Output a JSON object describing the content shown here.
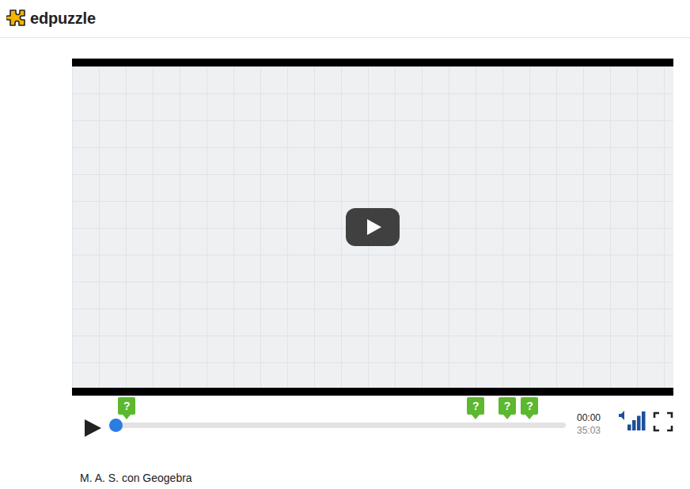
{
  "header": {
    "logo_text": "edpuzzle"
  },
  "video": {
    "title": "M. A. S. con Geogebra"
  },
  "player": {
    "playing": false,
    "level": 0,
    "current_time": "00:00",
    "duration": "35:03",
    "volume_level": 1,
    "question_markers": [
      {
        "label": "?",
        "at": 0.025
      },
      {
        "label": "?",
        "at": 0.8
      },
      {
        "label": "?",
        "at": 0.87
      },
      {
        "label": "?",
        "at": 0.92
      }
    ]
  }
}
